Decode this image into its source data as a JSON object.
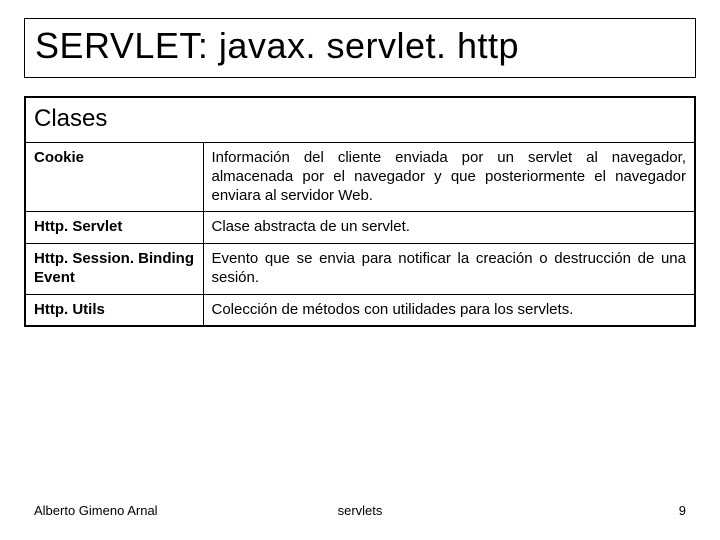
{
  "title": {
    "prefix": "SERVLET: ",
    "package": "javax. servlet. http"
  },
  "table": {
    "section_header": "Clases",
    "rows": [
      {
        "name": "Cookie",
        "desc": "Información del cliente enviada por un servlet al navegador, almacenada por el navegador y que posteriormente el navegador enviara al servidor Web."
      },
      {
        "name": "Http. Servlet",
        "desc": "Clase abstracta de un servlet."
      },
      {
        "name": "Http. Session. Binding Event",
        "desc": "Evento que se envia para notificar la creación o destrucción de una sesión."
      },
      {
        "name": "Http. Utils",
        "desc": "Colección de métodos con utilidades para los servlets."
      }
    ]
  },
  "footer": {
    "author": "Alberto Gimeno Arnal",
    "subject": "servlets",
    "page": "9"
  }
}
